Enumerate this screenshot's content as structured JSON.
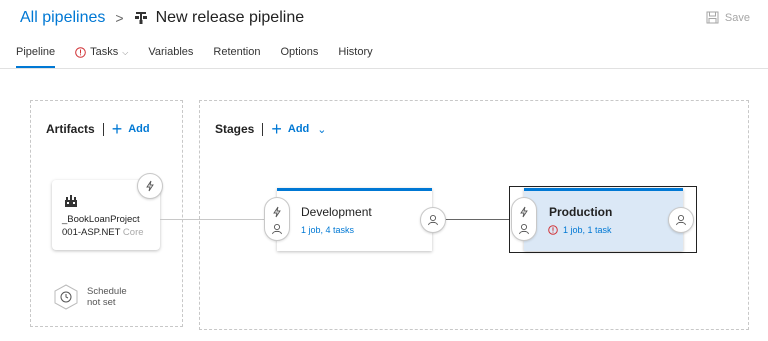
{
  "header": {
    "breadcrumb_root": "All pipelines",
    "separator": ">",
    "pipeline_title": "New release pipeline",
    "save_label": "Save"
  },
  "tabs": [
    {
      "label": "Pipeline",
      "active": true
    },
    {
      "label": "Tasks",
      "has_error": true,
      "has_dropdown": true
    },
    {
      "label": "Variables"
    },
    {
      "label": "Retention"
    },
    {
      "label": "Options"
    },
    {
      "label": "History"
    }
  ],
  "artifacts": {
    "heading": "Artifacts",
    "add_label": "Add",
    "card": {
      "name": "_BookLoanProject",
      "subtitle_visible": "001-ASP.NET",
      "subtitle_faded": " Core"
    },
    "schedule": {
      "line1": "Schedule",
      "line2": "not set"
    }
  },
  "stages": {
    "heading": "Stages",
    "add_label": "Add",
    "items": [
      {
        "name": "Development",
        "summary": "1 job, 4 tasks",
        "has_error": false
      },
      {
        "name": "Production",
        "summary": "1 job, 1 task",
        "has_error": true,
        "selected": true
      }
    ]
  },
  "colors": {
    "accent": "#0078d4",
    "error": "#d13438",
    "selected_stage_bg": "#dbe8f6"
  },
  "icons": {
    "pipeline": "pipeline-icon",
    "save": "save-icon",
    "error": "error-icon",
    "artifact": "build-artifact-icon",
    "trigger": "lightning-icon",
    "approver": "person-icon",
    "schedule": "clock-icon"
  }
}
